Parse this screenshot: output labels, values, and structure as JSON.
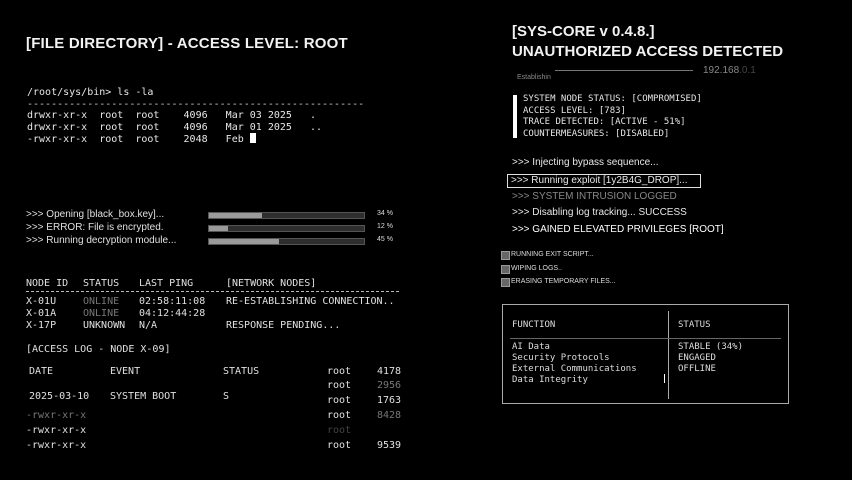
{
  "left_panel": {
    "title": "[FILE DIRECTORY] - ACCESS LEVEL: ROOT",
    "terminal": {
      "prompt": "/root/sys/bin> ls -la",
      "separator": "--------------------------------------------------------",
      "lines": [
        "drwxr-xr-x  root  root    4096   Mar 03 2025   .",
        "drwxr-xr-x  root  root    4096   Mar 01 2025   ..",
        "-rwxr-xr-x  root  root    2048   Feb "
      ]
    },
    "progress": [
      {
        "label": ">>> Opening [black_box.key]...",
        "percent": 34,
        "percent_text": "34 %"
      },
      {
        "label": ">>> ERROR: File is encrypted.",
        "percent": 12,
        "percent_text": "12 %"
      },
      {
        "label": ">>> Running decryption module...",
        "percent": 45,
        "percent_text": "45 %"
      }
    ],
    "nodes": {
      "headers": [
        "NODE ID",
        "STATUS",
        "LAST PING",
        "[NETWORK NODES]"
      ],
      "rows": [
        {
          "id": "X-01U",
          "status": "ONLINE",
          "ping": "02:58:11:08",
          "note": "RE-ESTABLISHING CONNECTION.."
        },
        {
          "id": "X-01A",
          "status": "ONLINE",
          "ping": "04:12:44:28",
          "note": ""
        },
        {
          "id": "X-17P",
          "status": "UNKNOWN",
          "ping": "N/A",
          "note": "RESPONSE PENDING..."
        }
      ]
    },
    "access_log": {
      "title": "[ACCESS LOG - NODE X-09]",
      "headers": [
        "DATE",
        "EVENT",
        "STATUS"
      ],
      "rows": [
        {
          "date": "",
          "event": "",
          "status": "",
          "owner": "root",
          "size": "4178"
        },
        {
          "date": "",
          "event": "",
          "status": "",
          "owner": "root",
          "size": "2956"
        },
        {
          "date": "2025-03-10",
          "event": "SYSTEM BOOT",
          "status": "S",
          "owner": "root",
          "size": "1763"
        },
        {
          "date": "-rwxr-xr-x",
          "event": "",
          "status": "",
          "owner": "root",
          "size": "8428"
        },
        {
          "date": "-rwxr-xr-x",
          "event": "",
          "status": "",
          "owner": "root",
          "size": ""
        },
        {
          "date": "-rwxr-xr-x",
          "event": "",
          "status": "",
          "owner": "root",
          "size": "9539"
        }
      ]
    }
  },
  "right_panel": {
    "title": "[SYS-CORE v 0.4.8.]",
    "subtitle": "UNAUTHORIZED ACCESS DETECTED",
    "establishing": "Establishin",
    "ip_bright": "192.168",
    "ip_dim": ".0.1",
    "status_lines": [
      "SYSTEM NODE STATUS: [COMPROMISED]",
      "ACCESS LEVEL: [783]",
      "TRACE DETECTED: [ACTIVE - 51%]",
      "COUNTERMEASURES: [DISABLED]"
    ],
    "commands": [
      ">>> Injecting bypass sequence...",
      ">>> Running exploit [1y2B4G_DROP]...",
      ">>> SYSTEM INTRUSION LOGGED",
      ">>> Disabling log tracking... SUCCESS",
      ">>> GAINED ELEVATED PRIVILEGES [ROOT]"
    ],
    "tasks": [
      "RUNNING EXIT SCRIPT...",
      "WIPING LOGS..",
      "ERASING TEMPORARY FILES..."
    ],
    "function_table": {
      "headers": [
        "FUNCTION",
        "STATUS"
      ],
      "functions": [
        "AI Data",
        "Security Protocols",
        "External Communications",
        "Data Integrity"
      ],
      "statuses": [
        "STABLE (34%)",
        "ENGAGED",
        "OFFLINE"
      ]
    }
  }
}
